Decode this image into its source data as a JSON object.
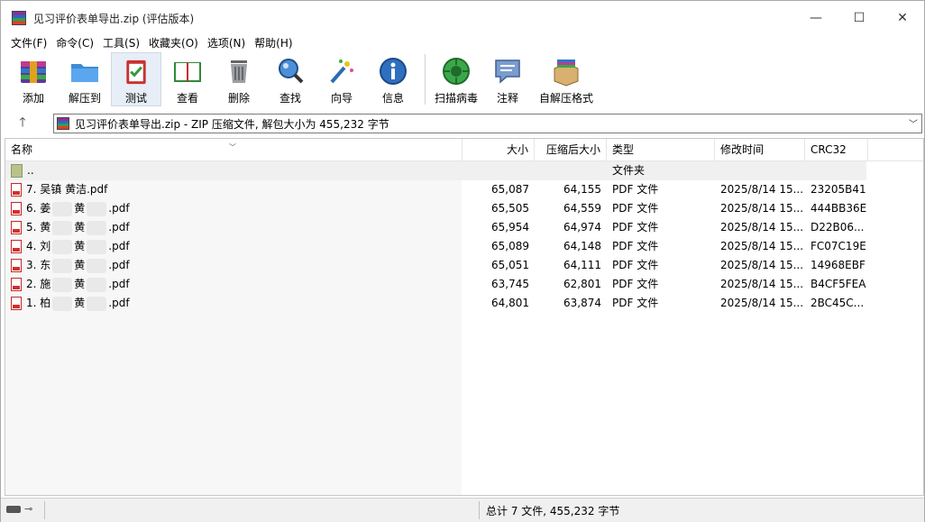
{
  "window": {
    "title": "见习评价表单导出.zip (评估版本)",
    "controls": {
      "minimize": "—",
      "maximize": "☐",
      "close": "✕"
    }
  },
  "menu": [
    {
      "label": "文件(F)"
    },
    {
      "label": "命令(C)"
    },
    {
      "label": "工具(S)"
    },
    {
      "label": "收藏夹(O)"
    },
    {
      "label": "选项(N)"
    },
    {
      "label": "帮助(H)"
    }
  ],
  "toolbar": [
    {
      "label": "添加",
      "icon": "add-archive-icon"
    },
    {
      "label": "解压到",
      "icon": "extract-folder-icon"
    },
    {
      "label": "测试",
      "icon": "test-clipboard-icon",
      "active": true
    },
    {
      "label": "查看",
      "icon": "view-book-icon"
    },
    {
      "label": "删除",
      "icon": "delete-trash-icon"
    },
    {
      "label": "查找",
      "icon": "find-magnifier-icon"
    },
    {
      "label": "向导",
      "icon": "wizard-wand-icon"
    },
    {
      "label": "信息",
      "icon": "info-icon"
    },
    {
      "label": "扫描病毒",
      "icon": "virus-scan-icon"
    },
    {
      "label": "注释",
      "icon": "comment-icon"
    },
    {
      "label": "自解压格式",
      "icon": "sfx-box-icon"
    }
  ],
  "address": {
    "text": "见习评价表单导出.zip - ZIP 压缩文件, 解包大小为 455,232 字节"
  },
  "columns": [
    "名称",
    "大小",
    "压缩后大小",
    "类型",
    "修改时间",
    "CRC32"
  ],
  "parent_row": {
    "name": "..",
    "type": "文件夹"
  },
  "files": [
    {
      "name_a": "7. 吴镇 黄洁.pdf",
      "name_b": "",
      "name_c": "",
      "size": "65,087",
      "packed": "64,155",
      "type": "PDF 文件",
      "modified": "2025/8/14 15...",
      "crc": "23205B41"
    },
    {
      "name_a": "6. 姜",
      "name_b": "黄",
      "name_c": ".pdf",
      "size": "65,505",
      "packed": "64,559",
      "type": "PDF 文件",
      "modified": "2025/8/14 15...",
      "crc": "444BB36E"
    },
    {
      "name_a": "5. 黄",
      "name_b": "黄",
      "name_c": ".pdf",
      "size": "65,954",
      "packed": "64,974",
      "type": "PDF 文件",
      "modified": "2025/8/14 15...",
      "crc": "D22B06..."
    },
    {
      "name_a": "4. 刘",
      "name_b": "黄",
      "name_c": ".pdf",
      "size": "65,089",
      "packed": "64,148",
      "type": "PDF 文件",
      "modified": "2025/8/14 15...",
      "crc": "FC07C19E"
    },
    {
      "name_a": "3. 东",
      "name_b": "黄",
      "name_c": ".pdf",
      "size": "65,051",
      "packed": "64,111",
      "type": "PDF 文件",
      "modified": "2025/8/14 15...",
      "crc": "14968EBF"
    },
    {
      "name_a": "2. 施",
      "name_b": "黄",
      "name_c": ".pdf",
      "size": "63,745",
      "packed": "62,801",
      "type": "PDF 文件",
      "modified": "2025/8/14 15...",
      "crc": "B4CF5FEA"
    },
    {
      "name_a": "1. 柏",
      "name_b": "黄",
      "name_c": ".pdf",
      "size": "64,801",
      "packed": "63,874",
      "type": "PDF 文件",
      "modified": "2025/8/14 15...",
      "crc": "2BC45C..."
    }
  ],
  "status": {
    "text": "总计 7 文件, 455,232 字节"
  },
  "colors": {
    "accent": "#e7eef7",
    "pdf_red": "#d32f2f",
    "folder": "#b8c38a"
  }
}
